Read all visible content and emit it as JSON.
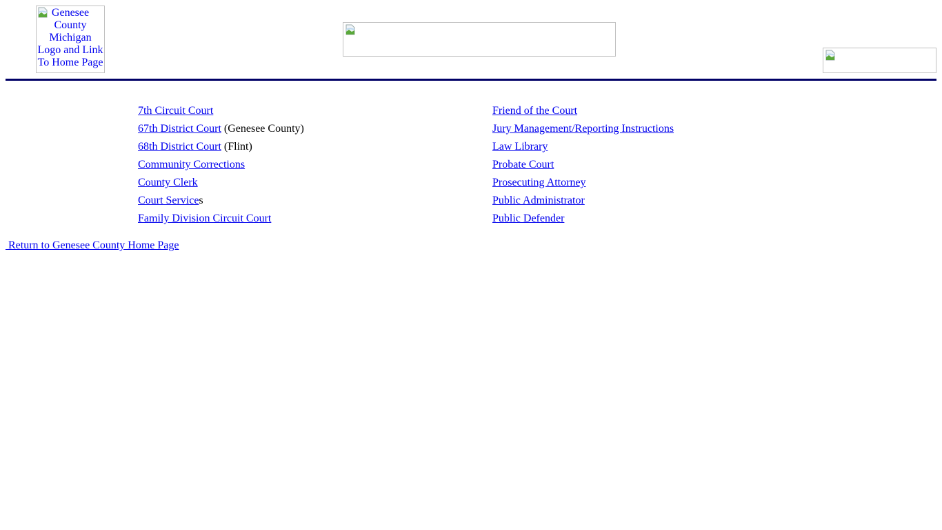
{
  "header": {
    "logo_alt": "Genesee County Michigan Logo and Link To Home Page",
    "banner_alt": "",
    "right_image_alt": "",
    "rule_color": "#000066"
  },
  "links": {
    "left": [
      {
        "label": "7th Circuit Court",
        "suffix": ""
      },
      {
        "label": "67th District Court",
        "suffix": " (Genesee County)"
      },
      {
        "label": "68th District Court",
        "suffix": " (Flint)"
      },
      {
        "label": "Community Corrections",
        "suffix": ""
      },
      {
        "label": "County Clerk",
        "suffix": ""
      },
      {
        "label": "Court Service",
        "suffix": "s"
      },
      {
        "label": "Family Division Circuit Court",
        "suffix": ""
      }
    ],
    "right": [
      {
        "label": "Friend of the Court",
        "suffix": ""
      },
      {
        "label": "Jury Management/Reporting Instructions",
        "suffix": ""
      },
      {
        "label": "Law Library",
        "suffix": ""
      },
      {
        "label": "Probate Court",
        "suffix": ""
      },
      {
        "label": "Prosecuting Attorney",
        "suffix": ""
      },
      {
        "label": "Public Administrator",
        "suffix": ""
      },
      {
        "label": "Public Defender",
        "suffix": ""
      }
    ]
  },
  "footer": {
    "return_label": " Return to Genesee County Home Page"
  },
  "colors": {
    "link": "#0000ee",
    "rule": "#000066"
  }
}
